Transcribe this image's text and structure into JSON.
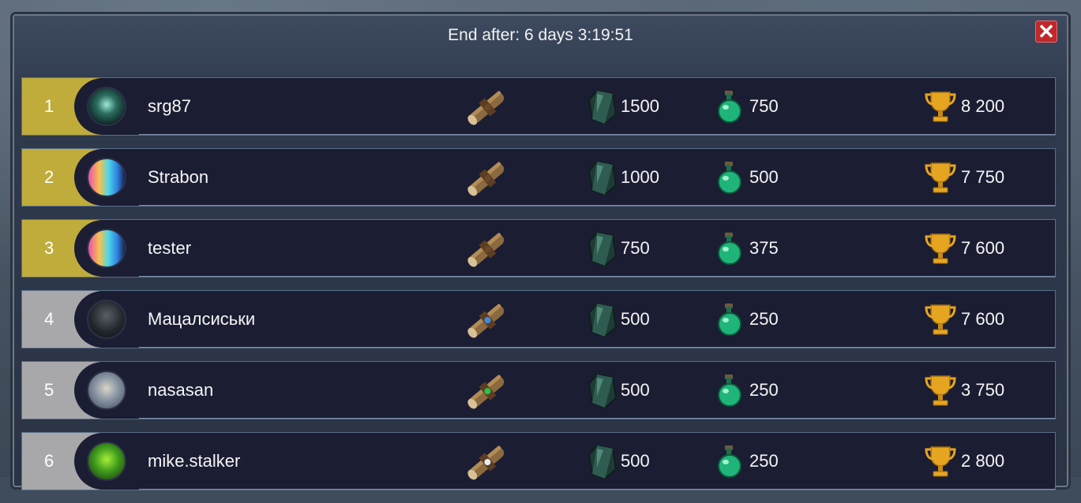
{
  "header": {
    "timer_text": "End after: 6 days 3:19:51",
    "close_symbol": "✕"
  },
  "colors": {
    "rank_gold": "#c0ac3a",
    "rank_grey": "#a8a8ab",
    "row_bg": "#1b1d33",
    "close_red": "#c0282b"
  },
  "leaderboard": [
    {
      "rank": "1",
      "name": "srg87",
      "avatar": "wolf-avatar-icon",
      "scroll_gem": "none",
      "crystals": "1500",
      "potions": "750",
      "trophies": "8 200",
      "tier": "gold"
    },
    {
      "rank": "2",
      "name": "Strabon",
      "avatar": "rainbow-horse-avatar-icon",
      "scroll_gem": "none",
      "crystals": "1000",
      "potions": "500",
      "trophies": "7 750",
      "tier": "gold"
    },
    {
      "rank": "3",
      "name": "tester",
      "avatar": "rainbow-horse-avatar-icon",
      "scroll_gem": "none",
      "crystals": "750",
      "potions": "375",
      "trophies": "7 600",
      "tier": "gold"
    },
    {
      "rank": "4",
      "name": "Мацалсиськи",
      "avatar": "dark-knight-avatar-icon",
      "scroll_gem": "blue",
      "crystals": "500",
      "potions": "250",
      "trophies": "7 600",
      "tier": "grey"
    },
    {
      "rank": "5",
      "name": "nasasan",
      "avatar": "warrior-avatar-icon",
      "scroll_gem": "green",
      "crystals": "500",
      "potions": "250",
      "trophies": "3 750",
      "tier": "grey"
    },
    {
      "rank": "6",
      "name": "mike.stalker",
      "avatar": "green-creature-avatar-icon",
      "scroll_gem": "white",
      "crystals": "500",
      "potions": "250",
      "trophies": "2 800",
      "tier": "grey"
    }
  ]
}
